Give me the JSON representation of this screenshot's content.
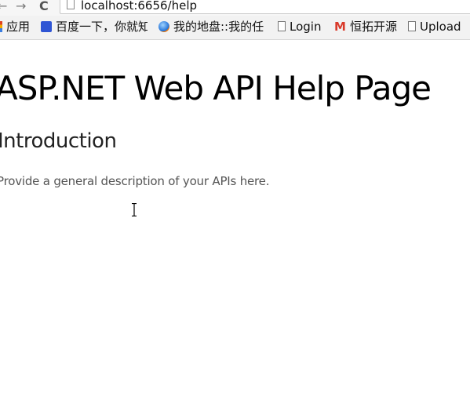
{
  "browser": {
    "url": "localhost:6656/help",
    "nav_back_glyph": "←",
    "nav_forward_glyph": "→",
    "reload_glyph": "C",
    "bookmarks": [
      {
        "label": "应用",
        "icon": "apps-icon"
      },
      {
        "label": "百度一下，你就知",
        "icon": "paw-icon"
      },
      {
        "label": "我的地盘::我的任",
        "icon": "globe-icon"
      },
      {
        "label": "Login",
        "icon": "page-icon"
      },
      {
        "label": "恒拓开源",
        "icon": "m-icon",
        "icon_text": "M"
      },
      {
        "label": "Upload",
        "icon": "page-icon"
      }
    ]
  },
  "page": {
    "title": "ASP.NET Web API Help Page",
    "section_title": "Introduction",
    "section_description": "Provide a general description of your APIs here."
  },
  "colors": {
    "chrome_bg": "#f2f2f2",
    "brand_m": "#d93a2b"
  }
}
